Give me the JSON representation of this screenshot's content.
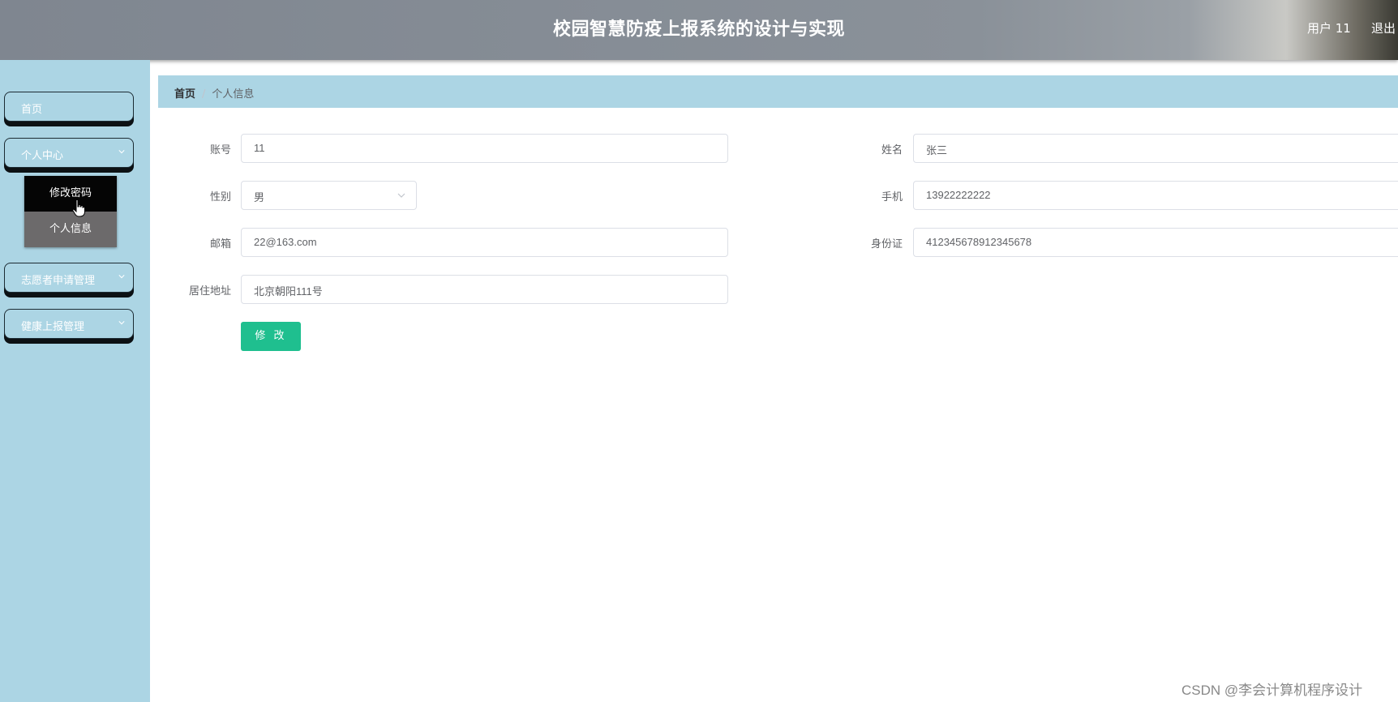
{
  "header": {
    "title": "校园智慧防疫上报系统的设计与实现",
    "user": "用户 11",
    "logout": "退出"
  },
  "sidebar": {
    "items": [
      {
        "label": "首页"
      },
      {
        "label": "个人中心",
        "icon": "chevron-down-icon"
      },
      {
        "label": "志愿者申请管理",
        "icon": "chevron-down-icon"
      },
      {
        "label": "健康上报管理",
        "icon": "chevron-down-icon"
      }
    ],
    "submenu": [
      {
        "label": "修改密码"
      },
      {
        "label": "个人信息"
      }
    ]
  },
  "breadcrumb": {
    "home": "首页",
    "separator": "/",
    "current": "个人信息"
  },
  "form": {
    "account_label": "账号",
    "account_value": "11",
    "name_label": "姓名",
    "name_value": "张三",
    "gender_label": "性别",
    "gender_value": "男",
    "phone_label": "手机",
    "phone_value": "13922222222",
    "email_label": "邮箱",
    "email_value": "22@163.com",
    "idcard_label": "身份证",
    "idcard_value": "412345678912345678",
    "address_label": "居住地址",
    "address_value": "北京朝阳111号",
    "submit_label": "修 改"
  },
  "watermark": "CSDN @李会计算机程序设计",
  "colors": {
    "sidebar_bg": "#acd5e4",
    "submit_button": "#1fbf8f",
    "header_bg": "#8a9199"
  }
}
